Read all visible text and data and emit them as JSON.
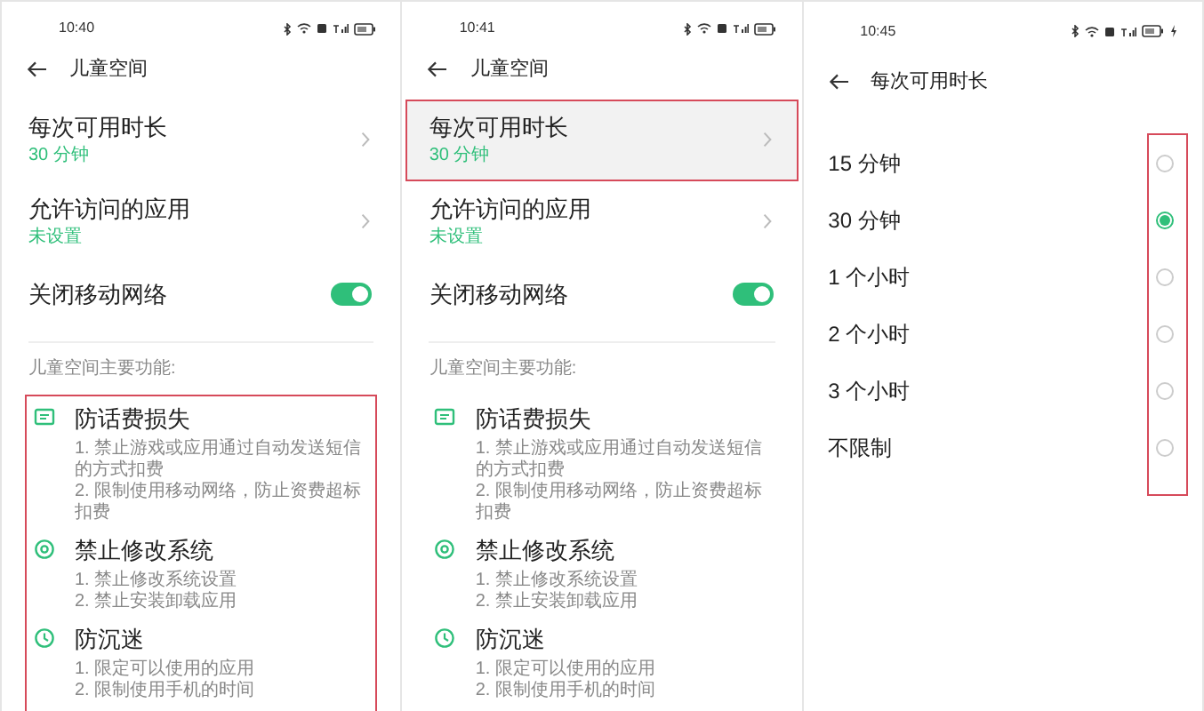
{
  "panels": [
    {
      "kind": "settings",
      "status": {
        "time": "10:40",
        "charging": false
      },
      "title": "儿童空间",
      "items": [
        {
          "kind": "link",
          "label": "每次可用时长",
          "value": "30 分钟",
          "highlighted": false
        },
        {
          "kind": "link",
          "label": "允许访问的应用",
          "value": "未设置",
          "highlighted": false
        },
        {
          "kind": "toggle",
          "label": "关闭移动网络",
          "on": true
        }
      ],
      "section_label": "儿童空间主要功能:",
      "features_highlighted": true,
      "features": [
        {
          "kind": "message",
          "title": "防话费损失",
          "lines": [
            "1. 禁止游戏或应用通过自动发送短信的方式扣费",
            "2. 限制使用移动网络，防止资费超标扣费"
          ]
        },
        {
          "kind": "gear",
          "title": "禁止修改系统",
          "lines": [
            "1. 禁止修改系统设置",
            "2. 禁止安装卸载应用"
          ]
        },
        {
          "kind": "clock",
          "title": "防沉迷",
          "lines": [
            "1. 限定可以使用的应用",
            "2. 限制使用手机的时间"
          ]
        }
      ]
    },
    {
      "kind": "settings",
      "status": {
        "time": "10:41",
        "charging": false
      },
      "title": "儿童空间",
      "items": [
        {
          "kind": "link",
          "label": "每次可用时长",
          "value": "30 分钟",
          "highlighted": true
        },
        {
          "kind": "link",
          "label": "允许访问的应用",
          "value": "未设置",
          "highlighted": false
        },
        {
          "kind": "toggle",
          "label": "关闭移动网络",
          "on": true
        }
      ],
      "section_label": "儿童空间主要功能:",
      "features_highlighted": false,
      "features": [
        {
          "kind": "message",
          "title": "防话费损失",
          "lines": [
            "1. 禁止游戏或应用通过自动发送短信的方式扣费",
            "2. 限制使用移动网络，防止资费超标扣费"
          ]
        },
        {
          "kind": "gear",
          "title": "禁止修改系统",
          "lines": [
            "1. 禁止修改系统设置",
            "2. 禁止安装卸载应用"
          ]
        },
        {
          "kind": "clock",
          "title": "防沉迷",
          "lines": [
            "1. 限定可以使用的应用",
            "2. 限制使用手机的时间"
          ]
        }
      ]
    },
    {
      "kind": "options",
      "status": {
        "time": "10:45",
        "charging": true
      },
      "title": "每次可用时长",
      "radios_highlighted": true,
      "options": [
        {
          "label": "15 分钟",
          "selected": false
        },
        {
          "label": "30 分钟",
          "selected": true
        },
        {
          "label": "1 个小时",
          "selected": false
        },
        {
          "label": "2 个小时",
          "selected": false
        },
        {
          "label": "3 个小时",
          "selected": false
        },
        {
          "label": "不限制",
          "selected": false
        }
      ]
    }
  ]
}
